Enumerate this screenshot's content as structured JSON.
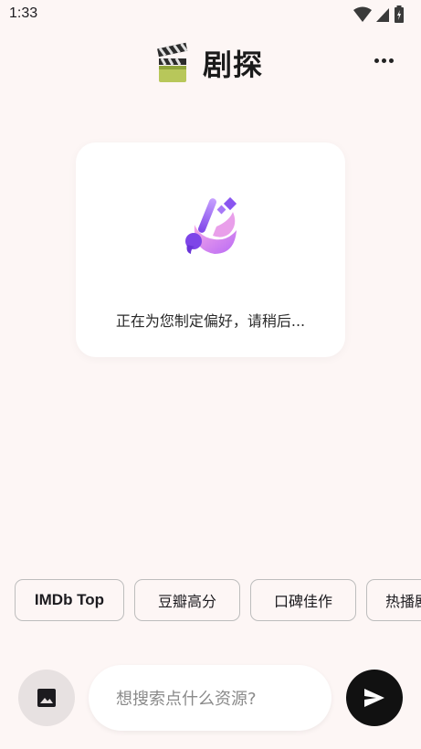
{
  "status_bar": {
    "time": "1:33"
  },
  "header": {
    "title": "剧探",
    "logo_icon": "clapperboard-icon",
    "menu_icon": "more-horizontal-icon"
  },
  "loading_card": {
    "icon": "magic-brush-icon",
    "message": "正在为您制定偏好，请稍后..."
  },
  "chips": [
    {
      "label": "IMDb Top"
    },
    {
      "label": "豆瓣高分"
    },
    {
      "label": "口碑佳作"
    },
    {
      "label": "热播剧"
    }
  ],
  "input_bar": {
    "image_icon": "image-icon",
    "placeholder": "想搜索点什么资源?",
    "value": "",
    "send_icon": "send-icon"
  },
  "colors": {
    "background": "#fdf6f5",
    "card": "#ffffff",
    "accent_purple": "#9b5cf0",
    "send_button": "#111111"
  }
}
